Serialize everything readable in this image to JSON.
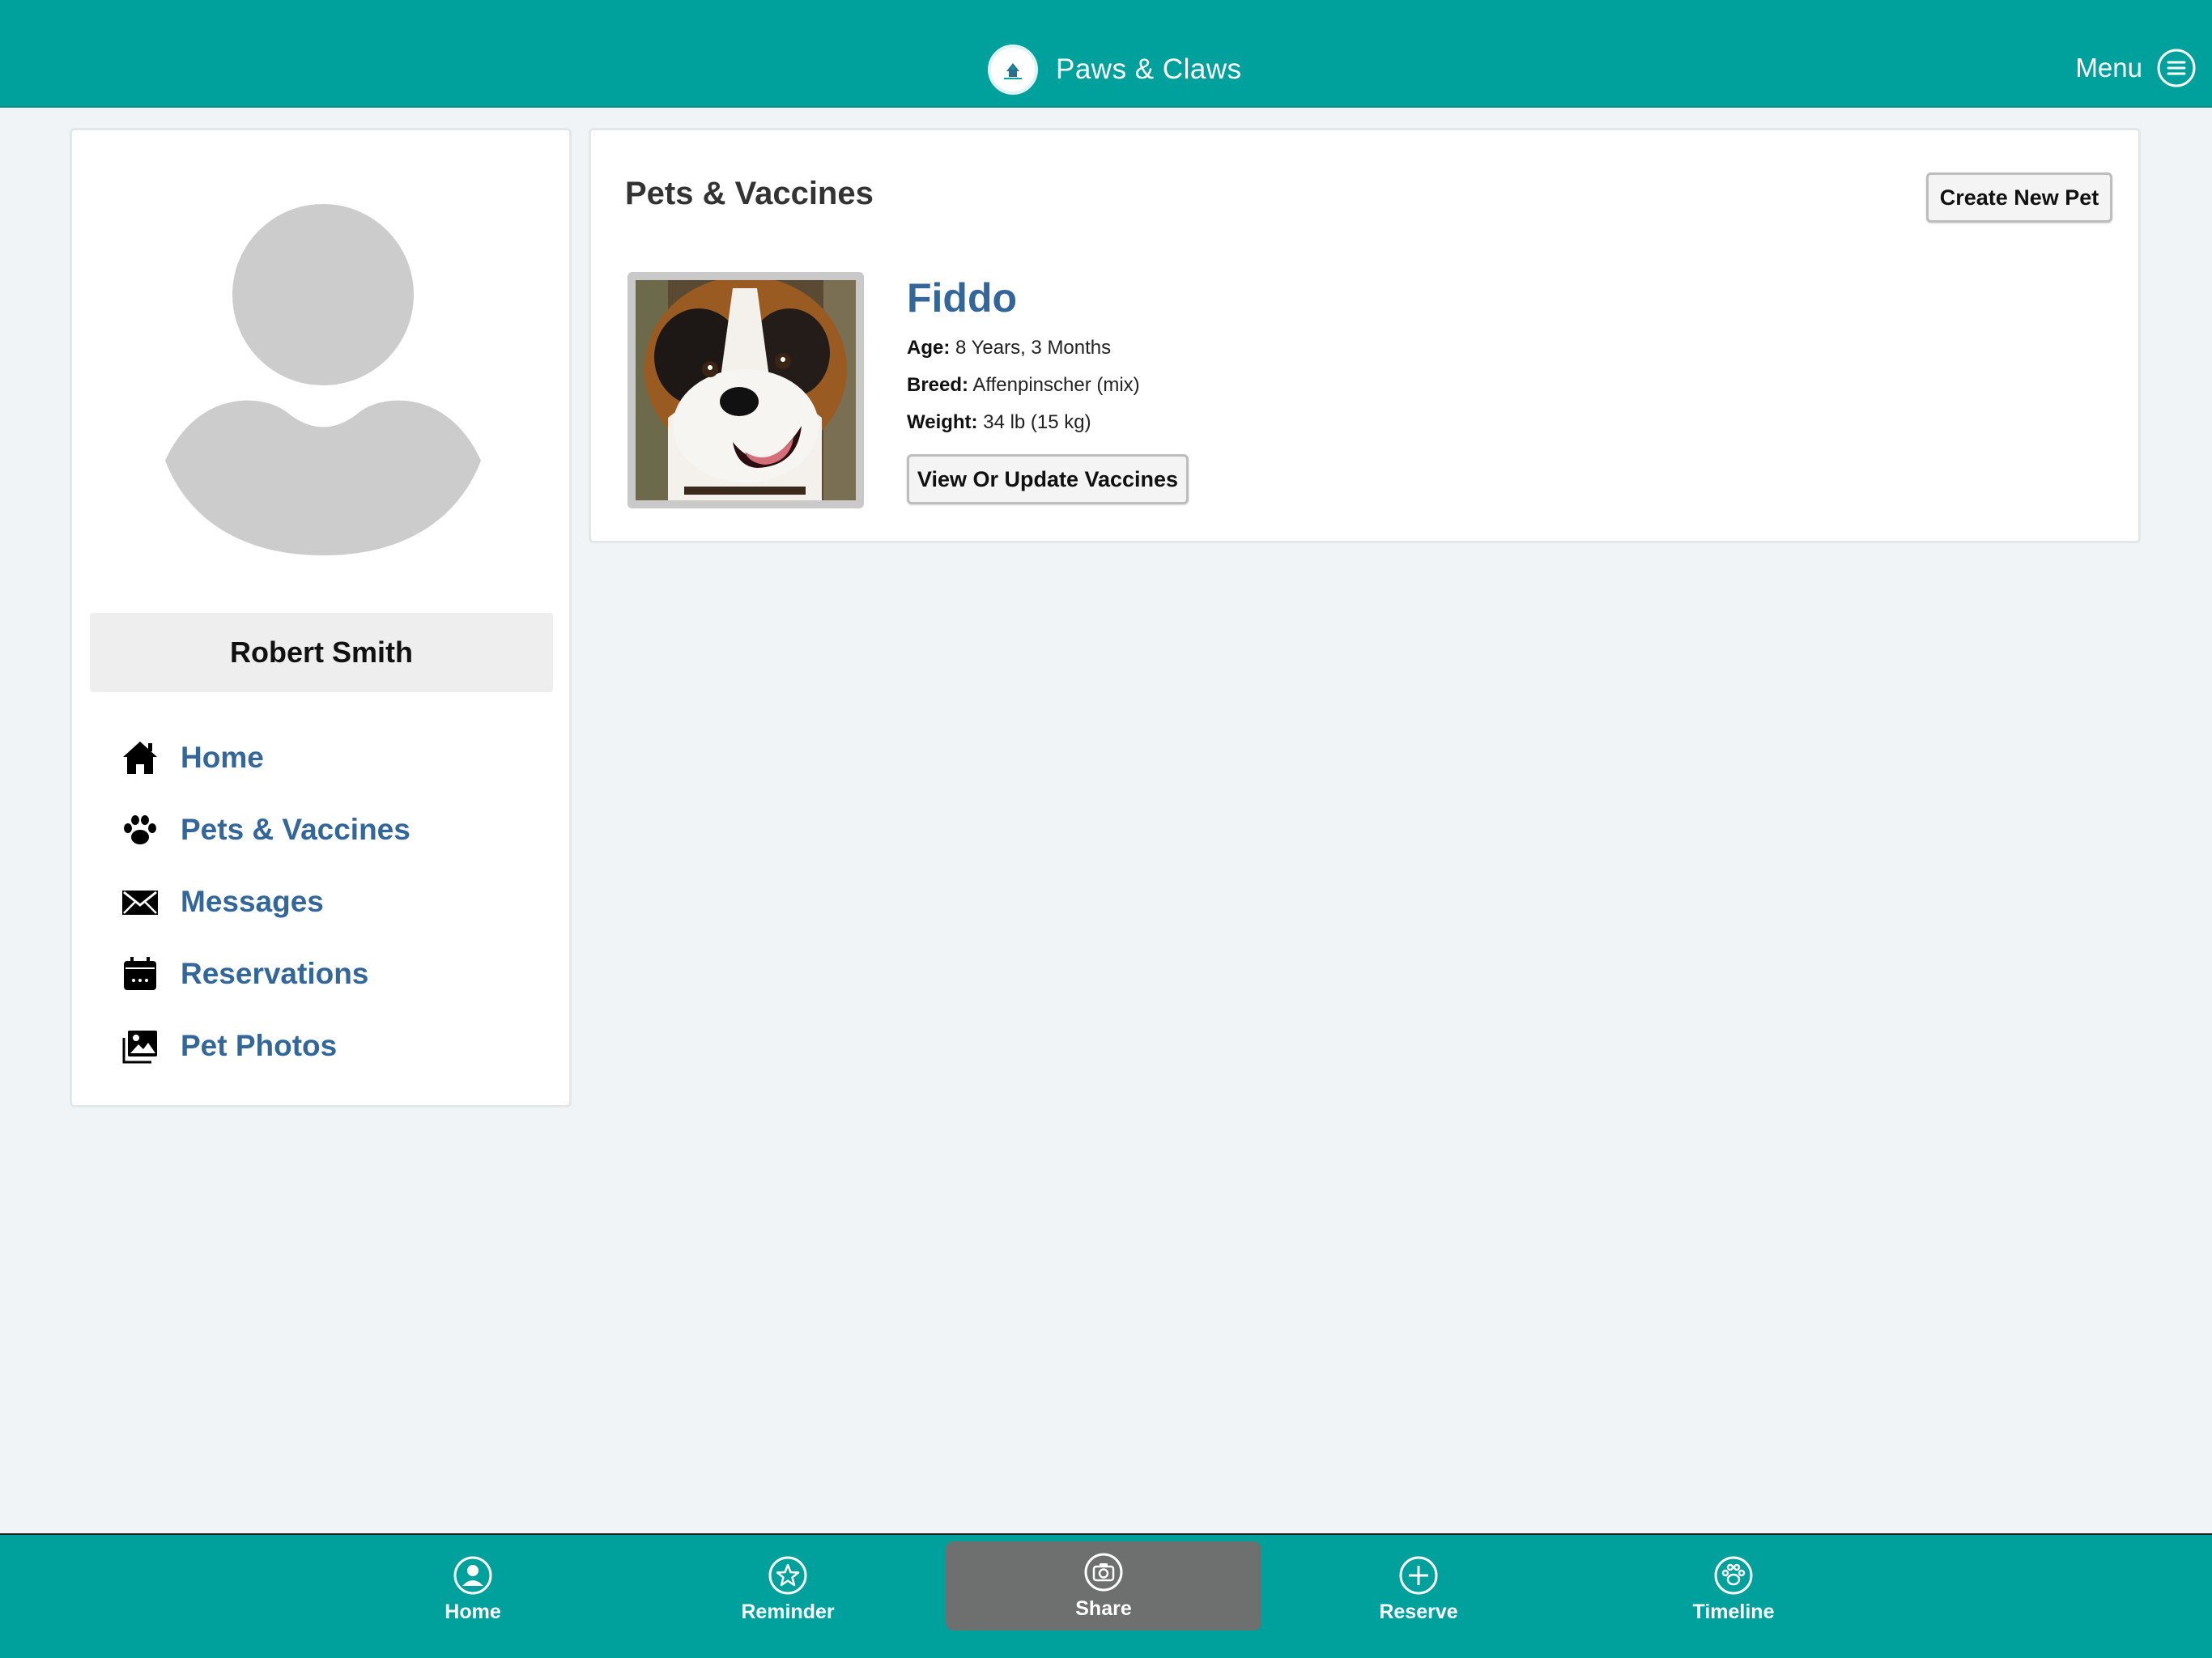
{
  "header": {
    "brand_name": "Paws & Claws",
    "menu_label": "Menu"
  },
  "colors": {
    "primary": "#00a19c",
    "link": "#336699",
    "active_tab": "#6e7070"
  },
  "sidebar": {
    "user_name": "Robert Smith",
    "items": [
      {
        "label": "Home",
        "icon": "home-icon"
      },
      {
        "label": "Pets & Vaccines",
        "icon": "paw-icon"
      },
      {
        "label": "Messages",
        "icon": "envelope-icon"
      },
      {
        "label": "Reservations",
        "icon": "calendar-icon"
      },
      {
        "label": "Pet Photos",
        "icon": "photos-icon"
      }
    ]
  },
  "main": {
    "title": "Pets & Vaccines",
    "create_button": "Create New Pet",
    "pet": {
      "name": "Fiddo",
      "age_label": "Age:",
      "age": "8 Years, 3 Months",
      "breed_label": "Breed:",
      "breed": "Affenpinscher (mix)",
      "weight_label": "Weight:",
      "weight": "34 lb (15 kg)",
      "vaccine_button": "View Or Update Vaccines"
    }
  },
  "bottom_nav": {
    "tabs": [
      {
        "label": "Home",
        "icon": "person-circle-icon"
      },
      {
        "label": "Reminder",
        "icon": "star-circle-icon"
      },
      {
        "label": "Share",
        "icon": "camera-circle-icon",
        "active": true
      },
      {
        "label": "Reserve",
        "icon": "plus-circle-icon"
      },
      {
        "label": "Timeline",
        "icon": "paw-circle-icon"
      }
    ]
  }
}
